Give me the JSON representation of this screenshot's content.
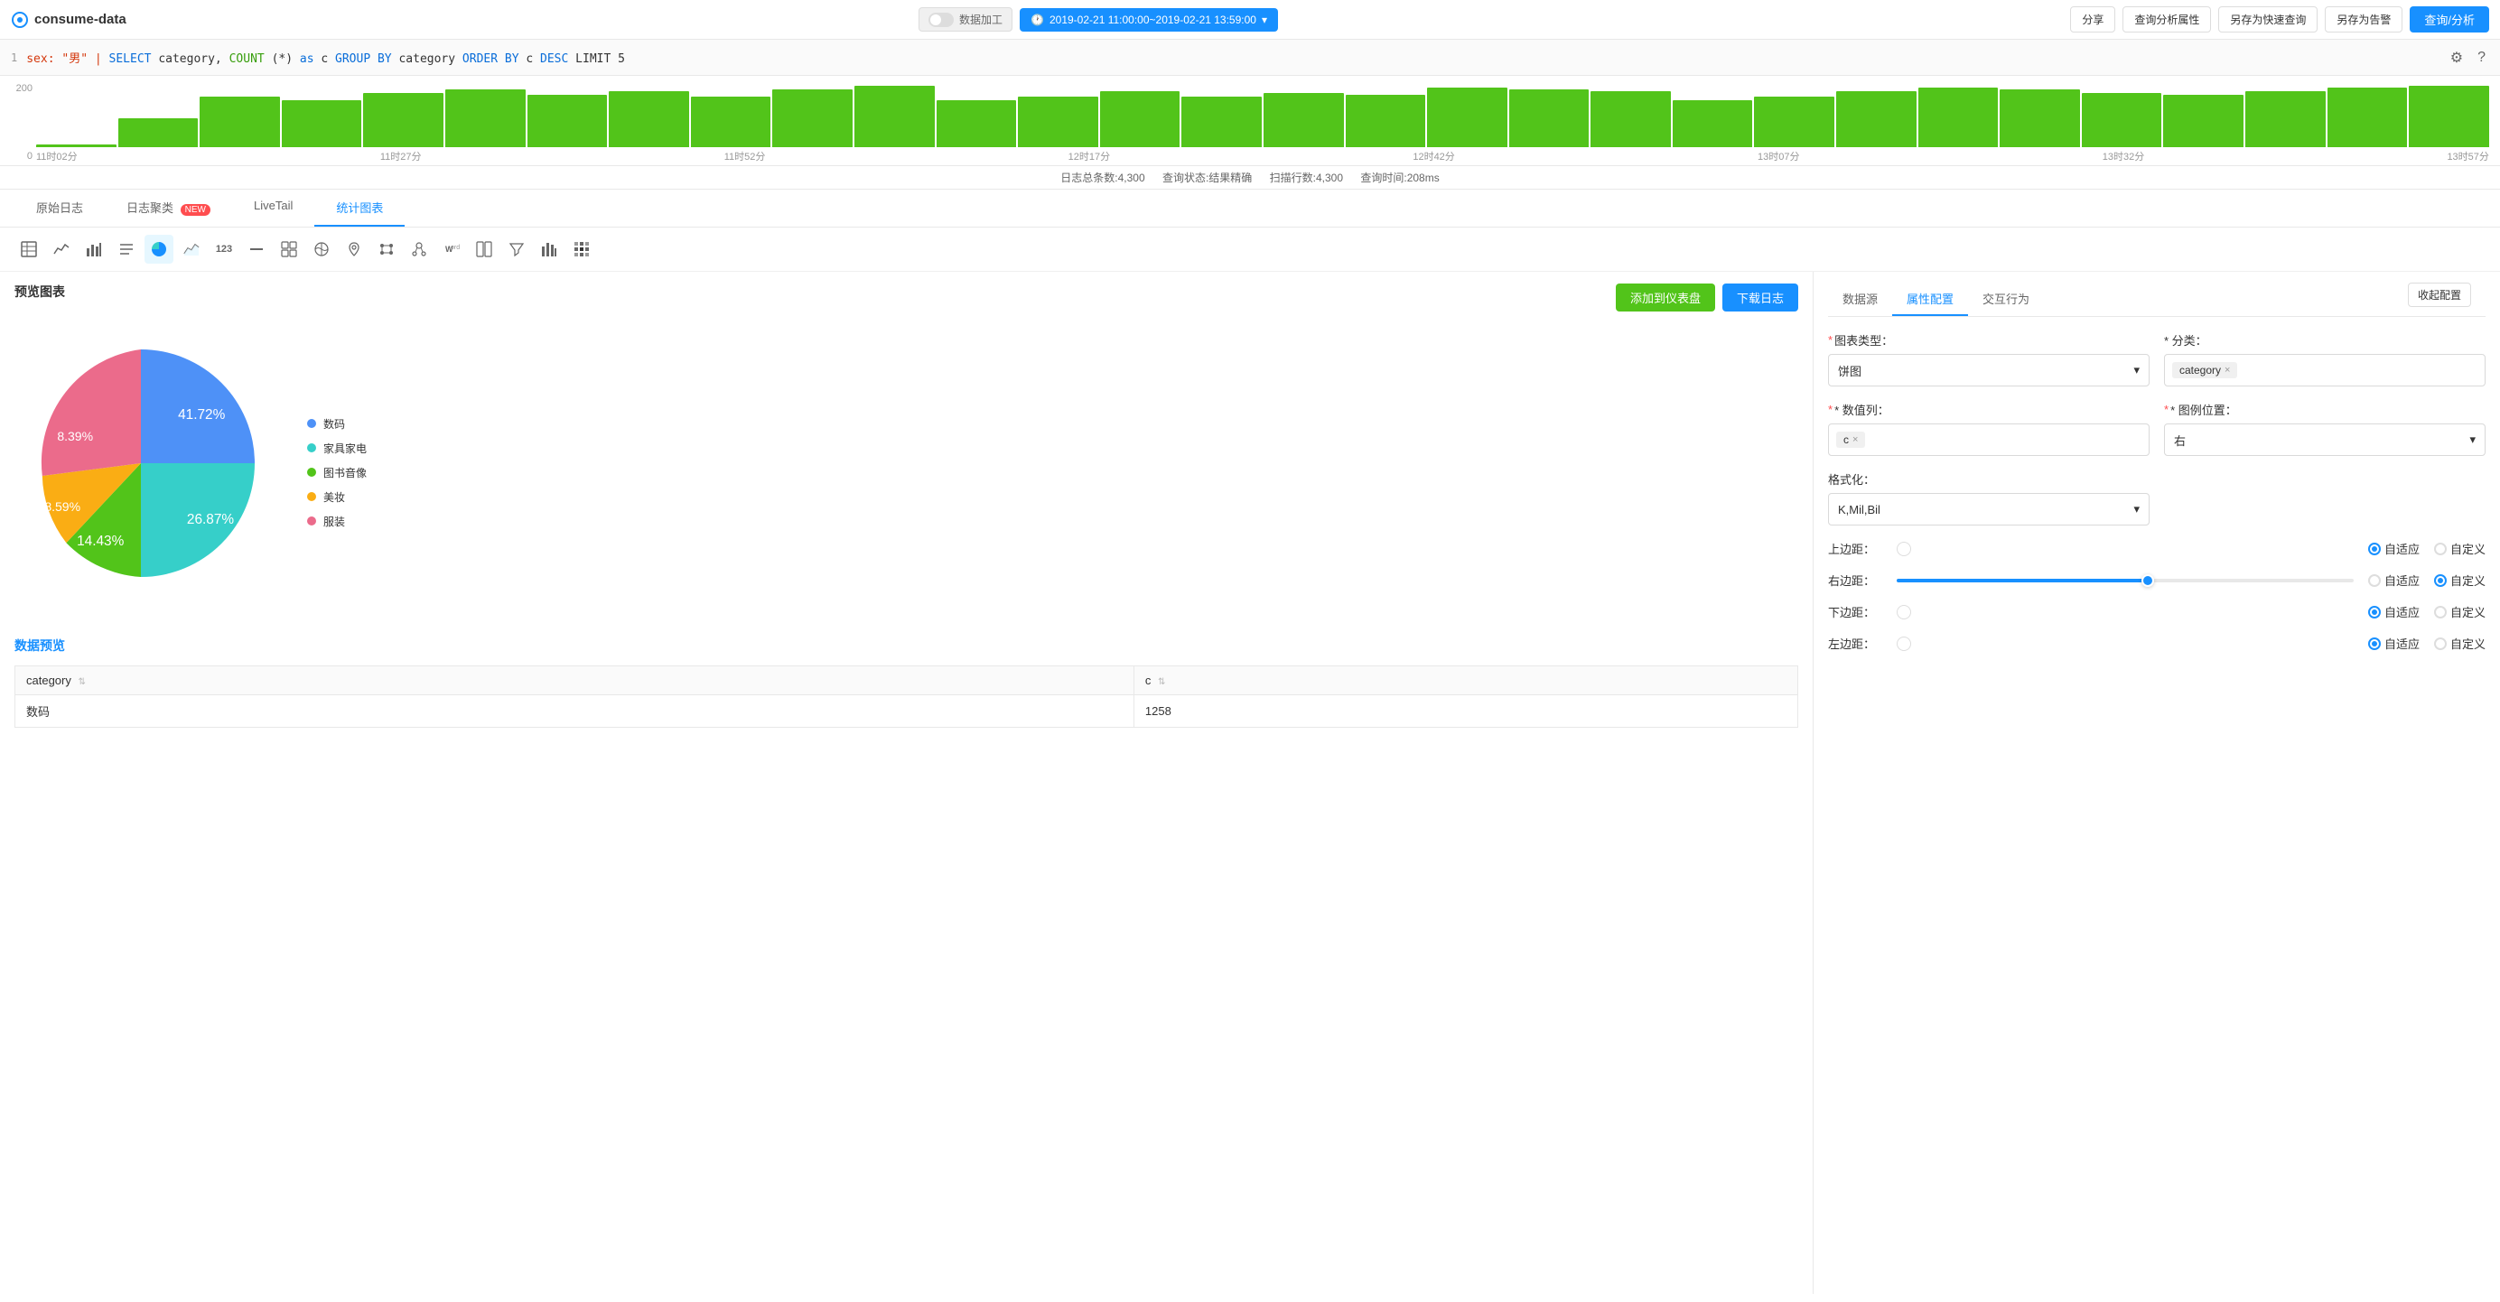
{
  "app": {
    "title": "consume-data"
  },
  "topbar": {
    "toggle_label": "数据加工",
    "time_range": "2019-02-21 11:00:00~2019-02-21 13:59:00",
    "share_label": "分享",
    "query_attr_label": "查询分析属性",
    "save_query_label": "另存为快速查询",
    "save_alert_label": "另存为告警",
    "query_btn_label": "查询/分析"
  },
  "sql": {
    "line": "1",
    "content_parts": [
      {
        "text": "sex: \"男\" | ",
        "type": "str"
      },
      {
        "text": "SELECT",
        "type": "kw"
      },
      {
        "text": " category, ",
        "type": "val"
      },
      {
        "text": "COUNT",
        "type": "fn"
      },
      {
        "text": "(*) as c ",
        "type": "val"
      },
      {
        "text": "GROUP BY",
        "type": "kw"
      },
      {
        "text": " category ",
        "type": "val"
      },
      {
        "text": "ORDER BY",
        "type": "kw"
      },
      {
        "text": " c ",
        "type": "val"
      },
      {
        "text": "DESC",
        "type": "kw"
      },
      {
        "text": " LIMIT 5",
        "type": "val"
      }
    ]
  },
  "histogram": {
    "y_max": "200",
    "y_min": "0",
    "x_labels": [
      "11时02分",
      "11时27分",
      "11时52分",
      "12时17分",
      "12时42分",
      "13时07分",
      "13时32分",
      "13时57分"
    ],
    "bars": [
      5,
      80,
      140,
      130,
      150,
      160,
      145,
      155,
      140,
      160,
      170,
      130,
      140,
      155,
      140,
      150,
      145,
      165,
      160,
      155,
      130,
      140,
      155,
      165,
      160,
      150,
      145,
      155,
      165,
      170
    ],
    "status": {
      "total": "日志总条数:4,300",
      "query_status": "查询状态:结果精确",
      "scan": "扫描行数:4,300",
      "time": "查询时间:208ms"
    }
  },
  "tabs": {
    "items": [
      {
        "label": "原始日志",
        "active": false
      },
      {
        "label": "日志聚类",
        "active": false,
        "badge": "NEW"
      },
      {
        "label": "LiveTail",
        "active": false
      },
      {
        "label": "统计图表",
        "active": true
      }
    ]
  },
  "chart_tools": [
    {
      "name": "table-icon",
      "icon": "⊞",
      "active": false
    },
    {
      "name": "line-chart-icon",
      "icon": "📈",
      "active": false
    },
    {
      "name": "bar-chart-icon",
      "icon": "📊",
      "active": false
    },
    {
      "name": "sort-icon",
      "icon": "≡",
      "active": false
    },
    {
      "name": "pie-chart-icon",
      "icon": "◕",
      "active": true
    },
    {
      "name": "area-chart-icon",
      "icon": "∿",
      "active": false
    },
    {
      "name": "number-icon",
      "icon": "123",
      "active": false
    },
    {
      "name": "gauge-icon",
      "icon": "—",
      "active": false
    },
    {
      "name": "scatter-icon",
      "icon": "⁞⁞",
      "active": false
    },
    {
      "name": "map-icon",
      "icon": "🗺",
      "active": false
    },
    {
      "name": "geo-icon",
      "icon": "📍",
      "active": false
    },
    {
      "name": "flow-icon",
      "icon": "🔄",
      "active": false
    },
    {
      "name": "relation-icon",
      "icon": "⚭",
      "active": false
    },
    {
      "name": "word-icon",
      "icon": "W",
      "active": false
    },
    {
      "name": "split-icon",
      "icon": "⊡",
      "active": false
    },
    {
      "name": "filter-icon",
      "icon": "⊽",
      "active": false
    },
    {
      "name": "column-chart-icon",
      "icon": "⦀",
      "active": false
    },
    {
      "name": "heatmap-icon",
      "icon": "▦",
      "active": false
    }
  ],
  "preview": {
    "title": "预览图表",
    "add_btn": "添加到仪表盘",
    "download_btn": "下载日志",
    "collapse_btn": "收起配置",
    "pie_data": [
      {
        "label": "数码",
        "value": 41.72,
        "color": "#4e91f7",
        "angle": 150
      },
      {
        "label": "家具家电",
        "value": 26.87,
        "color": "#36cfc9",
        "angle": 97
      },
      {
        "label": "图书音像",
        "value": 14.43,
        "color": "#52c41a",
        "angle": 52
      },
      {
        "label": "美妆",
        "value": 8.59,
        "color": "#faad14",
        "angle": 31
      },
      {
        "label": "服装",
        "value": 8.39,
        "color": "#eb6b8b",
        "angle": 30
      }
    ]
  },
  "data_preview": {
    "title": "数据预览",
    "columns": [
      "category",
      "c"
    ],
    "rows": [
      [
        "数码",
        "1258"
      ]
    ]
  },
  "right_panel": {
    "tabs": [
      "数据源",
      "属性配置",
      "交互行为"
    ],
    "active_tab": "属性配置",
    "chart_type_label": "图表类型：",
    "chart_type_value": "饼图",
    "category_label": "* 分类：",
    "category_tag": "category",
    "value_col_label": "* 数值列：",
    "value_col_tag": "c",
    "legend_pos_label": "* 图例位置：",
    "legend_pos_value": "右",
    "format_label": "格式化：",
    "format_value": "K,Mil,Bil",
    "margin_top_label": "上边距：",
    "margin_right_label": "右边距：",
    "margin_bottom_label": "下边距：",
    "margin_left_label": "左边距：",
    "adaptive_label": "自适应",
    "custom_label": "自定义",
    "slider_right_pct": 55
  }
}
